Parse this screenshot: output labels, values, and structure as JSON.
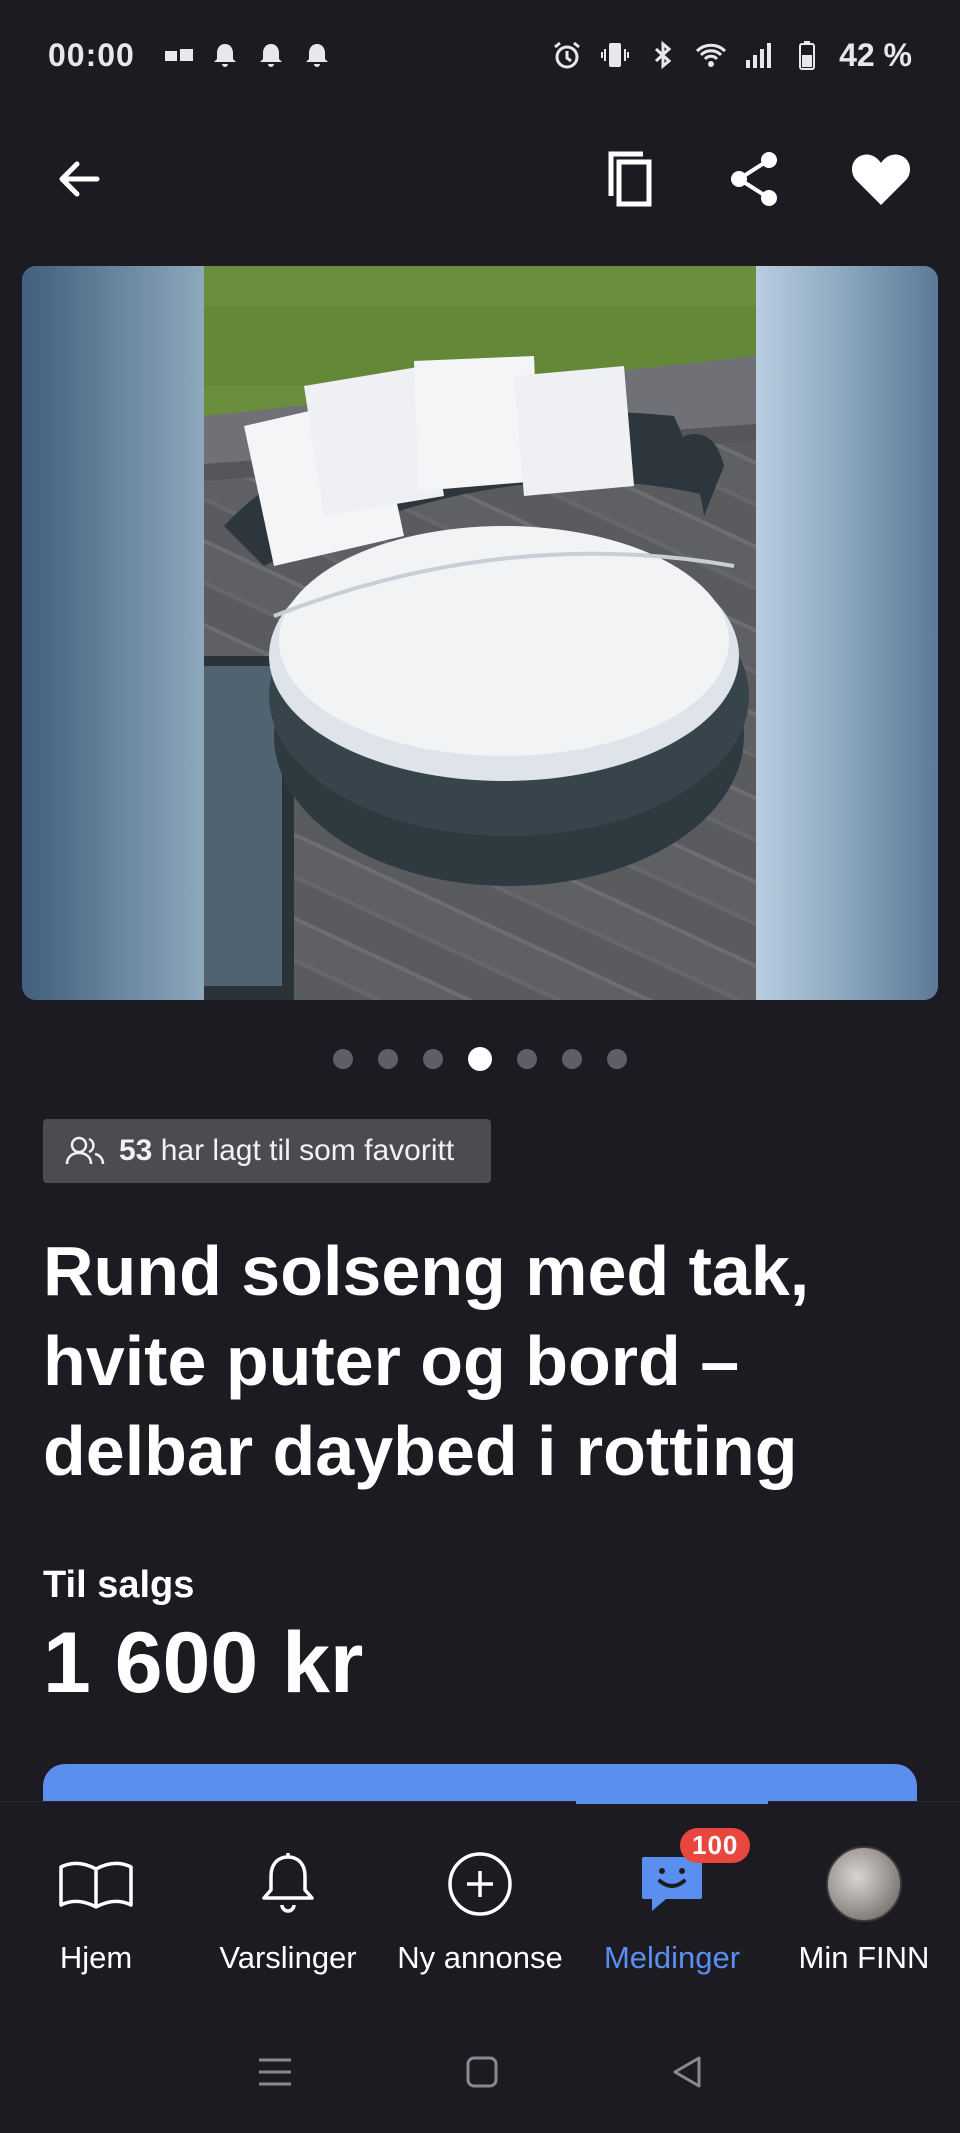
{
  "status_bar": {
    "time": "00:00",
    "battery": "42 %",
    "left_icons": [
      "sim-icon",
      "notification-bell-icon",
      "notification-bell-icon",
      "notification-bell-icon"
    ],
    "right_icons": [
      "alarm-icon",
      "vibrate-icon",
      "bluetooth-icon",
      "wifi-icon",
      "signal-icon",
      "battery-icon"
    ]
  },
  "app_bar": {
    "icons": [
      "back-arrow-icon",
      "copy-icon",
      "share-icon",
      "heart-icon"
    ]
  },
  "carousel": {
    "page_count": 7,
    "current_page": 4
  },
  "favorites": {
    "count": "53",
    "text": "har lagt til som favoritt"
  },
  "listing": {
    "title_lines": [
      "Rund solseng med tak,",
      "hvite puter og bord –",
      "delbar daybed i rotting"
    ],
    "sale_label": "Til salgs",
    "price": "1 600 kr"
  },
  "bottom_nav": {
    "items": [
      {
        "label": "Hjem",
        "icon": "book-icon"
      },
      {
        "label": "Varslinger",
        "icon": "bell-icon"
      },
      {
        "label": "Ny annonse",
        "icon": "plus-circle-icon"
      },
      {
        "label": "Meldinger",
        "icon": "chat-icon",
        "badge": "100"
      },
      {
        "label": "Min FINN",
        "icon": "avatar"
      }
    ],
    "active_index": 3
  },
  "colors": {
    "background": "#1c1b22",
    "accent": "#5b8fef",
    "badge": "#e8463e",
    "chip": "#4c4b52"
  }
}
